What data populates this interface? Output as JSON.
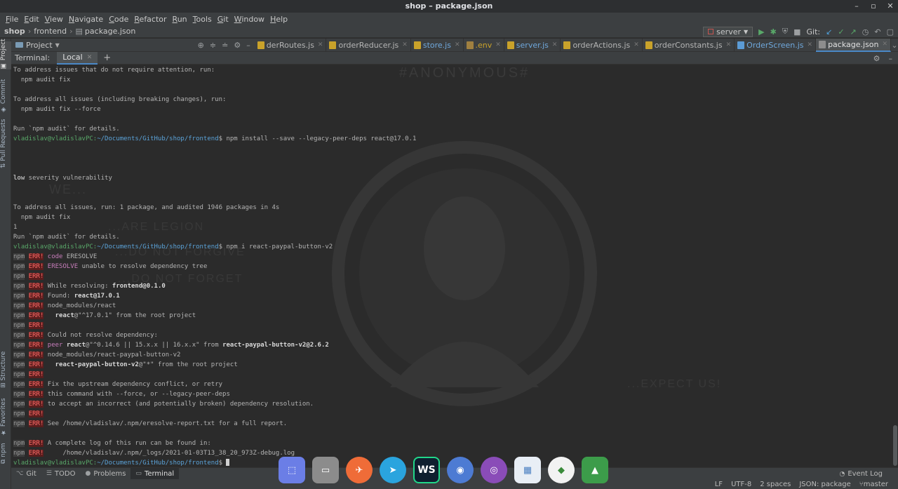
{
  "window": {
    "title": "shop – package.json"
  },
  "menu": [
    {
      "u": "F",
      "rest": "ile"
    },
    {
      "u": "E",
      "rest": "dit"
    },
    {
      "u": "V",
      "rest": "iew"
    },
    {
      "u": "N",
      "rest": "avigate"
    },
    {
      "u": "C",
      "rest": "ode"
    },
    {
      "u": "R",
      "rest": "efactor"
    },
    {
      "u": "R",
      "rest": "un"
    },
    {
      "u": "T",
      "rest": "ools"
    },
    {
      "u": "G",
      "rest": "it"
    },
    {
      "u": "W",
      "rest": "indow"
    },
    {
      "u": "H",
      "rest": "elp"
    }
  ],
  "breadcrumb": [
    "shop",
    "frontend",
    "package.json"
  ],
  "toolbar": {
    "run_config": "server",
    "git_label": "Git:"
  },
  "project_panel": {
    "label": "Project"
  },
  "tabs": [
    {
      "label": "derRoutes.js",
      "icon": "js",
      "active": false
    },
    {
      "label": "orderReducer.js",
      "icon": "js",
      "active": false
    },
    {
      "label": "store.js",
      "icon": "js",
      "active": false
    },
    {
      "label": ".env",
      "icon": "env",
      "active": false
    },
    {
      "label": "server.js",
      "icon": "js",
      "active": false
    },
    {
      "label": "orderActions.js",
      "icon": "js",
      "active": false
    },
    {
      "label": "orderConstants.js",
      "icon": "js",
      "active": false
    },
    {
      "label": "OrderScreen.js",
      "icon": "react",
      "active": false
    },
    {
      "label": "package.json",
      "icon": "json",
      "active": true
    }
  ],
  "terminal": {
    "label": "Terminal:",
    "tab": "Local",
    "watermark": [
      "#ANONYMOUS#",
      "WE...",
      "...ARE LEGION",
      "...DO NOT FORGIVE",
      "...DO NOT FORGET",
      "...EXPECT US!"
    ],
    "lines": [
      {
        "t": "text",
        "s": "To address issues that do not require attention, run:"
      },
      {
        "t": "text",
        "s": "  npm audit fix"
      },
      {
        "t": "text",
        "s": ""
      },
      {
        "t": "text",
        "s": "To address all issues (including breaking changes), run:"
      },
      {
        "t": "text",
        "s": "  npm audit fix --force"
      },
      {
        "t": "text",
        "s": ""
      },
      {
        "t": "text",
        "s": "Run `npm audit` for details."
      },
      {
        "t": "prompt",
        "user": "vladislav@vladislavPC",
        "path": "~/Documents/GitHub/shop/frontend",
        "cmd": "$ npm install --save --legacy-peer-deps react@17.0.1"
      },
      {
        "t": "text",
        "s": ""
      },
      {
        "t": "text",
        "s": ""
      },
      {
        "t": "text",
        "s": ""
      },
      {
        "t": "boldfirst",
        "b": "low",
        "s": " severity vulnerability"
      },
      {
        "t": "text",
        "s": ""
      },
      {
        "t": "text",
        "s": ""
      },
      {
        "t": "text",
        "s": "To address all issues, run: 1 package, and audited 1946 packages in 4s"
      },
      {
        "t": "text",
        "s": "  npm audit fix"
      },
      {
        "t": "text",
        "s": "1"
      },
      {
        "t": "text",
        "s": "Run `npm audit` for details."
      },
      {
        "t": "prompt",
        "user": "vladislav@vladislavPC",
        "path": "~/Documents/GitHub/shop/frontend",
        "cmd": "$ npm i react-paypal-button-v2"
      },
      {
        "t": "err",
        "kw": "code",
        "s": " ERESOLVE"
      },
      {
        "t": "err",
        "kw": "ERESOLVE",
        "s": " unable to resolve dependency tree"
      },
      {
        "t": "err",
        "s": ""
      },
      {
        "t": "err",
        "s": "While resolving: ",
        "b": "frontend@0.1.0"
      },
      {
        "t": "err",
        "s": "Found: ",
        "b": "react@17.0.1"
      },
      {
        "t": "err",
        "s": "node_modules/react"
      },
      {
        "t": "err",
        "s": "  ",
        "b": "react",
        "s2": "@\"^17.0.1\" from the root project"
      },
      {
        "t": "err",
        "s": ""
      },
      {
        "t": "err",
        "s": "Could not resolve dependency:"
      },
      {
        "t": "err",
        "kw": "peer",
        "s": " ",
        "b": "react",
        "s2": "@\"^0.14.6 || 15.x.x || 16.x.x\" from ",
        "b2": "react-paypal-button-v2@2.6.2"
      },
      {
        "t": "err",
        "s": "node_modules/react-paypal-button-v2"
      },
      {
        "t": "err",
        "s": "  ",
        "b": "react-paypal-button-v2",
        "s2": "@\"*\" from the root project"
      },
      {
        "t": "err",
        "s": ""
      },
      {
        "t": "err",
        "s": "Fix the upstream dependency conflict, or retry"
      },
      {
        "t": "err",
        "s": "this command with --force, or --legacy-peer-deps"
      },
      {
        "t": "err",
        "s": "to accept an incorrect (and potentially broken) dependency resolution."
      },
      {
        "t": "err",
        "s": ""
      },
      {
        "t": "err",
        "s": "See /home/vladislav/.npm/eresolve-report.txt for a full report."
      },
      {
        "t": "text",
        "s": ""
      },
      {
        "t": "err",
        "s": "A complete log of this run can be found in:"
      },
      {
        "t": "err",
        "s": "    /home/vladislav/.npm/_logs/2021-01-03T13_38_20_973Z-debug.log"
      },
      {
        "t": "prompt",
        "user": "vladislav@vladislavPC",
        "path": "~/Documents/GitHub/shop/frontend",
        "cmd": "$ ",
        "cursor": true
      }
    ]
  },
  "side_tabs": [
    "Project",
    "Commit",
    "Pull Requests",
    "Structure",
    "Favorites",
    "npm"
  ],
  "bottom_tabs": [
    {
      "label": "Git",
      "icon": "⌥",
      "active": false
    },
    {
      "label": "TODO",
      "icon": "☰",
      "active": false
    },
    {
      "label": "Problems",
      "icon": "●",
      "active": false
    },
    {
      "label": "Terminal",
      "icon": "▭",
      "active": true
    }
  ],
  "event_log": "Event Log",
  "status": [
    "LF",
    "UTF-8",
    "2 spaces",
    "JSON: package",
    "master"
  ],
  "npm_tag": "npm",
  "err_tag": "ERR!",
  "dock": [
    {
      "name": "screenshot-app",
      "glyph": "⬚",
      "bg": "#6b7ee6"
    },
    {
      "name": "files-app",
      "glyph": "▭",
      "bg": "#8c8c8c"
    },
    {
      "name": "postman-app",
      "glyph": "✈",
      "bg": "#ef6c38"
    },
    {
      "name": "telegram-app",
      "glyph": "➤",
      "bg": "#2aa4de"
    },
    {
      "name": "webstorm-app",
      "glyph": "WS",
      "bg": "#0f1f2f"
    },
    {
      "name": "chromium-app",
      "glyph": "◉",
      "bg": "#4d7bd3"
    },
    {
      "name": "github-desktop-app",
      "glyph": "◎",
      "bg": "#8a4cb8"
    },
    {
      "name": "store-app",
      "glyph": "▦",
      "bg": "#e8eef5"
    },
    {
      "name": "mongodb-compass-app",
      "glyph": "◆",
      "bg": "#f2f2f2"
    },
    {
      "name": "launcher-app",
      "glyph": "▲",
      "bg": "#3c9c4a"
    }
  ]
}
